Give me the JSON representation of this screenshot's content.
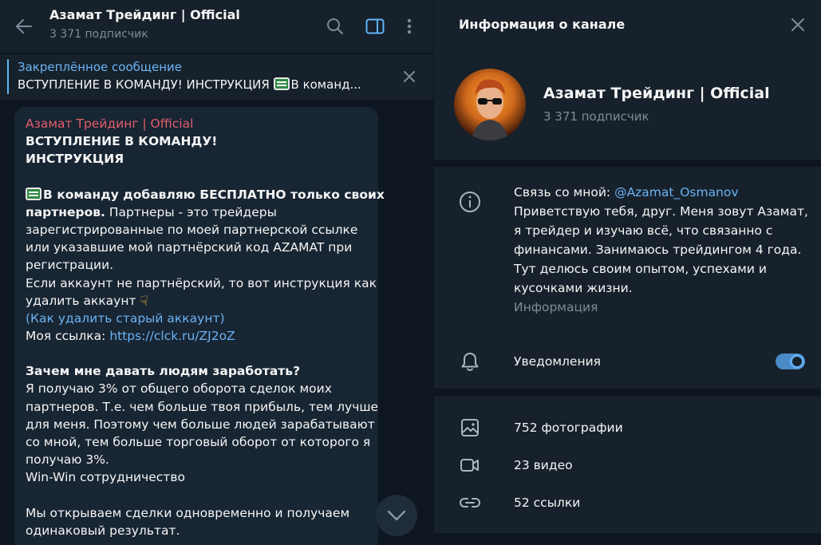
{
  "chat": {
    "title": "Азамат Трейдинг | Official",
    "subscribers": "3 371 подписчик",
    "icons": [
      "back-arrow-icon",
      "search-icon",
      "sidebar-toggle-icon",
      "more-vertical-icon"
    ]
  },
  "pinned": {
    "title": "Закреплённое сообщение",
    "text": "ВСТУПЛЕНИЕ В КОМАНДУ! ИНСТРУКЦИЯ ",
    "text_tail": "В команд...",
    "icons": [
      "terminal-emoji-icon",
      "close-icon"
    ]
  },
  "message": {
    "author": "Азамат Трейдинг | Official",
    "heading_1": "ВСТУПЛЕНИЕ В КОМАНДУ!",
    "heading_2": "ИНСТРУКЦИЯ",
    "p1_bold_1": "В команду добавляю БЕСПЛАТНО только своих",
    "p1_bold_2": "партнеров.",
    "p1_l2_rest": " Партнеры - это трейдеры",
    "p1_l3": "зарегистрированные по моей партнерской ссылке",
    "p1_l4": "или указавшие мой партнёрский код AZAMAT при",
    "p1_l5": "регистрации.",
    "p1_l6": "Если аккаунт не партнёрский, то вот инструкция как",
    "p1_l7": "удалить аккаунт ",
    "p1_l8_link": "(Как удалить старый аккаунт)",
    "p1_l9_label": "Моя ссылка: ",
    "p1_l9_link": "https://clck.ru/ZJ2oZ",
    "q_heading": "Зачем мне давать людям заработать?",
    "q_l1": "Я получаю 3% от общего оборота сделок моих",
    "q_l2": "партнеров. Т.е. чем больше твоя прибыль, тем лучше",
    "q_l3": "для меня. Поэтому чем больше людей зарабатывают",
    "q_l4": "со мной, тем больше торговый оборот от которого я",
    "q_l5": "получаю 3%.",
    "q_l6": "Win-Win сотрудничество",
    "last_l1": "Мы открываем сделки одновременно и получаем",
    "last_l2": "одинаковый результат.",
    "icons": [
      "terminal-emoji-icon",
      "pointing-down-hand-icon",
      "scroll-down-icon"
    ]
  },
  "panel": {
    "title": "Информация о канале",
    "channel_name": "Азамат Трейдинг | Official",
    "subscribers": "3 371 подписчик",
    "desc_prefix": "Связь со мной: ",
    "desc_handle": "@Azamat_Osmanov",
    "desc_l2": "Приветствую тебя, друг. Меня зовут Азамат,",
    "desc_l3": "я трейдер и изучаю всё, что связанно с",
    "desc_l4": "финансами. Занимаюсь трейдингом 4 года.",
    "desc_l5": "Тут делюсь своим опытом, успехами и",
    "desc_l6": "кусочками жизни.",
    "desc_caption": "Информация",
    "notifications_label": "Уведомления",
    "notifications_on": true,
    "photos_label": "752 фотографии",
    "videos_label": "23 видео",
    "links_label": "52 ссылки",
    "icons": [
      "close-icon",
      "info-icon",
      "bell-icon",
      "photo-icon",
      "video-icon",
      "link-icon"
    ]
  },
  "colors": {
    "accent": "#6ab3f3",
    "author": "#e35d6a",
    "panel_bg": "#17212b",
    "chat_bg": "#0e1621",
    "bubble_bg": "#182533",
    "muted": "#7d8b99",
    "toggle": "#4b8bc7"
  }
}
